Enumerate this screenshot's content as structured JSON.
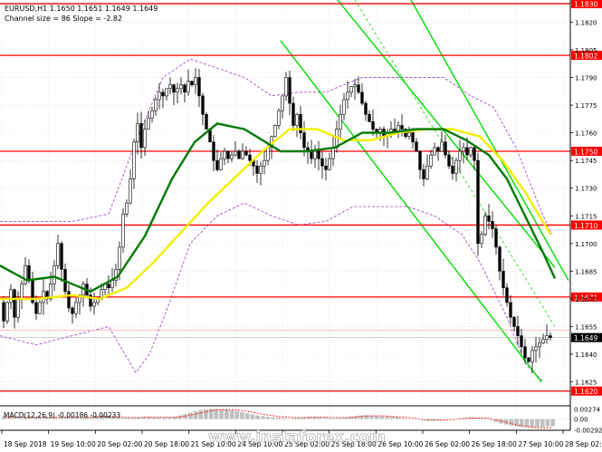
{
  "chart_data": {
    "type": "candlestick",
    "header": {
      "symbol_line": "EURUSD,H1  1.1650 1.1651 1.1649 1.1649",
      "channel_line": "Channel size = 86 Slope = -2.82"
    },
    "ylim": [
      1.16125,
      1.1832
    ],
    "y_ticks": [
      "1.1820",
      "1.1805",
      "1.1790",
      "1.1775",
      "1.1760",
      "1.1745",
      "1.1730",
      "1.1715",
      "1.1700",
      "1.1685",
      "1.1670",
      "1.1655",
      "1.1640",
      "1.1625"
    ],
    "x_ticks": [
      "18 Sep 2018",
      "19 Sep 10:00",
      "20 Sep 02:00",
      "20 Sep 18:00",
      "21 Sep 10:00",
      "24 Sep 10:00",
      "25 Sep 02:00",
      "25 Sep 18:00",
      "26 Sep 10:00",
      "26 Sep 02:00",
      "26 Sep 18:00",
      "27 Sep 10:00",
      "28 Sep 02:00"
    ],
    "levels": [
      {
        "label": "1.1830",
        "value": 1.183
      },
      {
        "label": "1.1802",
        "value": 1.1802
      },
      {
        "label": "1.1750",
        "value": 1.175
      },
      {
        "label": "1.1710",
        "value": 1.171
      },
      {
        "label": "1.1671",
        "value": 1.1671
      },
      {
        "label": "1.1620",
        "value": 1.162
      }
    ],
    "current_price": {
      "label": "1.1649",
      "value": 1.1649
    },
    "bid_label": "1.1653",
    "price_path": [
      [
        0,
        1.1668
      ],
      [
        4,
        1.1658
      ],
      [
        8,
        1.1668
      ],
      [
        12,
        1.1675
      ],
      [
        16,
        1.166
      ],
      [
        20,
        1.167
      ],
      [
        24,
        1.1678
      ],
      [
        28,
        1.1688
      ],
      [
        32,
        1.168
      ],
      [
        36,
        1.1668
      ],
      [
        40,
        1.1662
      ],
      [
        44,
        1.1668
      ],
      [
        48,
        1.1674
      ],
      [
        52,
        1.167
      ],
      [
        56,
        1.1678
      ],
      [
        60,
        1.1688
      ],
      [
        64,
        1.17
      ],
      [
        68,
        1.1686
      ],
      [
        72,
        1.1674
      ],
      [
        76,
        1.1665
      ],
      [
        80,
        1.1662
      ],
      [
        84,
        1.1668
      ],
      [
        88,
        1.1672
      ],
      [
        92,
        1.1678
      ],
      [
        96,
        1.1672
      ],
      [
        100,
        1.1666
      ],
      [
        104,
        1.1668
      ],
      [
        108,
        1.167
      ],
      [
        112,
        1.1675
      ],
      [
        116,
        1.1678
      ],
      [
        120,
        1.1676
      ],
      [
        124,
        1.168
      ],
      [
        128,
        1.1686
      ],
      [
        132,
        1.1698
      ],
      [
        136,
        1.1716
      ],
      [
        140,
        1.1722
      ],
      [
        144,
        1.1735
      ],
      [
        148,
        1.1755
      ],
      [
        152,
        1.1765
      ],
      [
        156,
        1.1752
      ],
      [
        160,
        1.1762
      ],
      [
        164,
        1.1768
      ],
      [
        168,
        1.1772
      ],
      [
        172,
        1.1778
      ],
      [
        176,
        1.1782
      ],
      [
        180,
        1.178
      ],
      [
        184,
        1.1784
      ],
      [
        188,
        1.1786
      ],
      [
        192,
        1.1782
      ],
      [
        196,
        1.1784
      ],
      [
        200,
        1.1786
      ],
      [
        204,
        1.1782
      ],
      [
        208,
        1.1788
      ],
      [
        212,
        1.1786
      ],
      [
        216,
        1.179
      ],
      [
        220,
        1.178
      ],
      [
        224,
        1.177
      ],
      [
        228,
        1.1762
      ],
      [
        232,
        1.1755
      ],
      [
        236,
        1.1745
      ],
      [
        240,
        1.174
      ],
      [
        244,
        1.1746
      ],
      [
        248,
        1.175
      ],
      [
        252,
        1.1746
      ],
      [
        256,
        1.1748
      ],
      [
        260,
        1.175
      ],
      [
        264,
        1.1746
      ],
      [
        268,
        1.175
      ],
      [
        272,
        1.1748
      ],
      [
        276,
        1.1745
      ],
      [
        280,
        1.1742
      ],
      [
        284,
        1.1738
      ],
      [
        288,
        1.1742
      ],
      [
        292,
        1.1745
      ],
      [
        296,
        1.1752
      ],
      [
        300,
        1.1758
      ],
      [
        304,
        1.1764
      ],
      [
        308,
        1.1772
      ],
      [
        312,
        1.178
      ],
      [
        316,
        1.179
      ],
      [
        320,
        1.1776
      ],
      [
        324,
        1.1764
      ],
      [
        328,
        1.177
      ],
      [
        332,
        1.176
      ],
      [
        336,
        1.1752
      ],
      [
        340,
        1.175
      ],
      [
        344,
        1.1746
      ],
      [
        348,
        1.175
      ],
      [
        352,
        1.1746
      ],
      [
        356,
        1.1742
      ],
      [
        360,
        1.174
      ],
      [
        364,
        1.1746
      ],
      [
        368,
        1.1752
      ],
      [
        372,
        1.1762
      ],
      [
        376,
        1.177
      ],
      [
        380,
        1.1778
      ],
      [
        384,
        1.1782
      ],
      [
        388,
        1.1785
      ],
      [
        392,
        1.1786
      ],
      [
        396,
        1.1782
      ],
      [
        400,
        1.1776
      ],
      [
        404,
        1.177
      ],
      [
        408,
        1.1766
      ],
      [
        412,
        1.1762
      ],
      [
        416,
        1.176
      ],
      [
        420,
        1.1762
      ],
      [
        424,
        1.1758
      ],
      [
        428,
        1.176
      ],
      [
        432,
        1.1762
      ],
      [
        436,
        1.176
      ],
      [
        440,
        1.1764
      ],
      [
        444,
        1.1762
      ],
      [
        448,
        1.1758
      ],
      [
        452,
        1.176
      ],
      [
        456,
        1.1755
      ],
      [
        460,
        1.175
      ],
      [
        464,
        1.174
      ],
      [
        468,
        1.1735
      ],
      [
        472,
        1.1742
      ],
      [
        476,
        1.1748
      ],
      [
        480,
        1.1752
      ],
      [
        484,
        1.175
      ],
      [
        488,
        1.1755
      ],
      [
        492,
        1.1748
      ],
      [
        496,
        1.1742
      ],
      [
        500,
        1.1738
      ],
      [
        504,
        1.1745
      ],
      [
        508,
        1.175
      ],
      [
        512,
        1.1752
      ],
      [
        516,
        1.1748
      ],
      [
        520,
        1.1752
      ],
      [
        524,
        1.1745
      ],
      [
        528,
        1.17
      ],
      [
        532,
        1.1705
      ],
      [
        536,
        1.1715
      ],
      [
        540,
        1.1712
      ],
      [
        544,
        1.1708
      ],
      [
        548,
        1.1698
      ],
      [
        552,
        1.1685
      ],
      [
        556,
        1.1676
      ],
      [
        560,
        1.1668
      ],
      [
        564,
        1.166
      ],
      [
        568,
        1.1655
      ],
      [
        572,
        1.165
      ],
      [
        576,
        1.1644
      ],
      [
        580,
        1.1638
      ],
      [
        584,
        1.1636
      ],
      [
        588,
        1.1642
      ],
      [
        592,
        1.1644
      ],
      [
        596,
        1.1646
      ],
      [
        600,
        1.1648
      ],
      [
        604,
        1.165
      ],
      [
        608,
        1.1649
      ]
    ],
    "sma_green": [
      [
        0,
        1.1688
      ],
      [
        30,
        1.168
      ],
      [
        60,
        1.1682
      ],
      [
        100,
        1.1674
      ],
      [
        130,
        1.1682
      ],
      [
        160,
        1.1704
      ],
      [
        190,
        1.1735
      ],
      [
        215,
        1.1755
      ],
      [
        240,
        1.1765
      ],
      [
        270,
        1.1762
      ],
      [
        290,
        1.1756
      ],
      [
        310,
        1.175
      ],
      [
        340,
        1.175
      ],
      [
        370,
        1.1752
      ],
      [
        400,
        1.176
      ],
      [
        430,
        1.176
      ],
      [
        460,
        1.1762
      ],
      [
        490,
        1.1762
      ],
      [
        515,
        1.1756
      ],
      [
        540,
        1.1748
      ],
      [
        560,
        1.1735
      ],
      [
        580,
        1.1715
      ],
      [
        600,
        1.1695
      ],
      [
        613,
        1.1681
      ]
    ],
    "sma_yellow": [
      [
        0,
        1.167
      ],
      [
        40,
        1.167
      ],
      [
        80,
        1.1672
      ],
      [
        110,
        1.167
      ],
      [
        140,
        1.1676
      ],
      [
        170,
        1.169
      ],
      [
        200,
        1.1706
      ],
      [
        230,
        1.1722
      ],
      [
        260,
        1.1736
      ],
      [
        290,
        1.175
      ],
      [
        320,
        1.1762
      ],
      [
        350,
        1.1762
      ],
      [
        380,
        1.1756
      ],
      [
        410,
        1.1756
      ],
      [
        440,
        1.176
      ],
      [
        470,
        1.1762
      ],
      [
        500,
        1.1762
      ],
      [
        530,
        1.1758
      ],
      [
        555,
        1.1745
      ],
      [
        580,
        1.1728
      ],
      [
        608,
        1.1705
      ]
    ],
    "envelope_upper": [
      [
        0,
        1.1712
      ],
      [
        40,
        1.1712
      ],
      [
        80,
        1.1712
      ],
      [
        120,
        1.1716
      ],
      [
        150,
        1.1755
      ],
      [
        180,
        1.179
      ],
      [
        210,
        1.18
      ],
      [
        240,
        1.1795
      ],
      [
        270,
        1.179
      ],
      [
        300,
        1.178
      ],
      [
        330,
        1.1782
      ],
      [
        360,
        1.1782
      ],
      [
        400,
        1.179
      ],
      [
        430,
        1.179
      ],
      [
        460,
        1.179
      ],
      [
        490,
        1.179
      ],
      [
        520,
        1.178
      ],
      [
        545,
        1.1774
      ],
      [
        570,
        1.1752
      ],
      [
        600,
        1.1715
      ],
      [
        610,
        1.1705
      ]
    ],
    "envelope_lower": [
      [
        0,
        1.165
      ],
      [
        40,
        1.1645
      ],
      [
        80,
        1.165
      ],
      [
        120,
        1.1655
      ],
      [
        150,
        1.163
      ],
      [
        165,
        1.164
      ],
      [
        185,
        1.1665
      ],
      [
        210,
        1.17
      ],
      [
        240,
        1.1715
      ],
      [
        270,
        1.1722
      ],
      [
        300,
        1.1715
      ],
      [
        330,
        1.171
      ],
      [
        360,
        1.1712
      ],
      [
        390,
        1.172
      ],
      [
        420,
        1.172
      ],
      [
        450,
        1.172
      ],
      [
        480,
        1.1715
      ],
      [
        510,
        1.1705
      ],
      [
        530,
        1.169
      ],
      [
        560,
        1.166
      ],
      [
        580,
        1.1635
      ],
      [
        600,
        1.1625
      ]
    ],
    "channel_lines": [
      {
        "from": [
          373,
          1.1832
        ],
        "to": [
          613,
          1.1687
        ]
      },
      {
        "from": [
          310,
          1.181
        ],
        "to": [
          598,
          1.1625
        ]
      },
      {
        "from": [
          454,
          1.1832
        ],
        "to": [
          628,
          1.168
        ]
      }
    ],
    "channel_mid_dashed": {
      "from": [
        392,
        1.1832
      ],
      "to": [
        613,
        1.1655
      ]
    },
    "macd": {
      "label": "MACD(12,26,9)  -0.00186  -0.00233",
      "ylim": [
        -0.0031,
        0.0029
      ],
      "y_ticks": [
        "0.00274",
        "0.00",
        "-0.00292"
      ],
      "histogram": [
        0.0008,
        0.0006,
        0.0005,
        0.0004,
        0.0004,
        0.0005,
        0.0004,
        0.0005,
        0.0006,
        0.0005,
        0.0004,
        0.0005,
        0.0006,
        0.0005,
        0.0004,
        0.0004,
        0.0005,
        0.0006,
        0.0008,
        0.001,
        0.0009,
        0.0006,
        0.0004,
        0.0003,
        0.0003,
        0.0004,
        0.0005,
        0.0006,
        0.0006,
        0.0005,
        0.0004,
        0.0004,
        0.0005,
        0.0006,
        0.001,
        0.0014,
        0.0018,
        0.0022,
        0.0025,
        0.0027,
        0.0028,
        0.0028,
        0.0027,
        0.0026,
        0.0024,
        0.0022,
        0.0019,
        0.0016,
        0.0013,
        0.001,
        0.0008,
        0.0006,
        0.0005,
        0.0004,
        0.0003,
        0.0002,
        0.0003,
        0.0004,
        0.0005,
        0.0006,
        0.0006,
        0.0005,
        0.0004,
        0.0003,
        0.0002,
        0.0003,
        0.0004,
        0.0006,
        0.0008,
        0.001,
        0.0011,
        0.001,
        0.0009,
        0.0008,
        0.0007,
        0.0006,
        0.0005,
        0.0003,
        0.0001,
        0.0,
        -0.0002,
        -0.0004,
        -0.0005,
        -0.0004,
        -0.0003,
        -0.0002,
        -0.0001,
        0.0001,
        0.0003,
        0.0004,
        0.0005,
        0.0004,
        0.0003,
        0.0002,
        -0.0003,
        -0.0008,
        -0.0012,
        -0.0015,
        -0.0018,
        -0.002,
        -0.0022,
        -0.0023,
        -0.0024,
        -0.0023,
        -0.0022,
        -0.002,
        -0.0019
      ],
      "signal": [
        0.0006,
        0.0005,
        0.0005,
        0.0005,
        0.0005,
        0.0005,
        0.0005,
        0.0005,
        0.0005,
        0.0005,
        0.0005,
        0.0005,
        0.0005,
        0.0005,
        0.0005,
        0.0005,
        0.0005,
        0.0006,
        0.0006,
        0.0007,
        0.0007,
        0.0007,
        0.0006,
        0.0005,
        0.0004,
        0.0004,
        0.0004,
        0.0005,
        0.0005,
        0.0005,
        0.0005,
        0.0005,
        0.0005,
        0.0005,
        0.0006,
        0.0008,
        0.0011,
        0.0014,
        0.0017,
        0.002,
        0.0023,
        0.0025,
        0.0026,
        0.0026,
        0.0026,
        0.0025,
        0.0023,
        0.0021,
        0.0019,
        0.0016,
        0.0013,
        0.0011,
        0.0009,
        0.0007,
        0.0006,
        0.0005,
        0.0004,
        0.0004,
        0.0004,
        0.0005,
        0.0005,
        0.0005,
        0.0005,
        0.0004,
        0.0004,
        0.0004,
        0.0004,
        0.0005,
        0.0006,
        0.0007,
        0.0008,
        0.0009,
        0.0009,
        0.0009,
        0.0008,
        0.0007,
        0.0006,
        0.0005,
        0.0004,
        0.0003,
        0.0001,
        -0.0001,
        -0.0002,
        -0.0003,
        -0.0003,
        -0.0003,
        -0.0002,
        -0.0001,
        0.0,
        0.0001,
        0.0002,
        0.0003,
        0.0003,
        0.0003,
        0.0001,
        -0.0002,
        -0.0006,
        -0.0009,
        -0.0013,
        -0.0016,
        -0.0019,
        -0.0021,
        -0.0023,
        -0.0024,
        -0.0024,
        -0.0024,
        -0.0023
      ]
    },
    "watermark": "www.instaforex.com",
    "colors": {
      "level": "#ff0000",
      "level_label_bg": "#ff0000",
      "grid": "#e6e6e6",
      "candle": "#000000",
      "channel": "#00dd00",
      "sma_green": "#007a00",
      "sma_yellow": "#f2ee00",
      "envelope": "#a050c0",
      "macd_hist": "#c0c0c0",
      "macd_signal": "#ff0000",
      "current_bg": "#000000"
    }
  }
}
